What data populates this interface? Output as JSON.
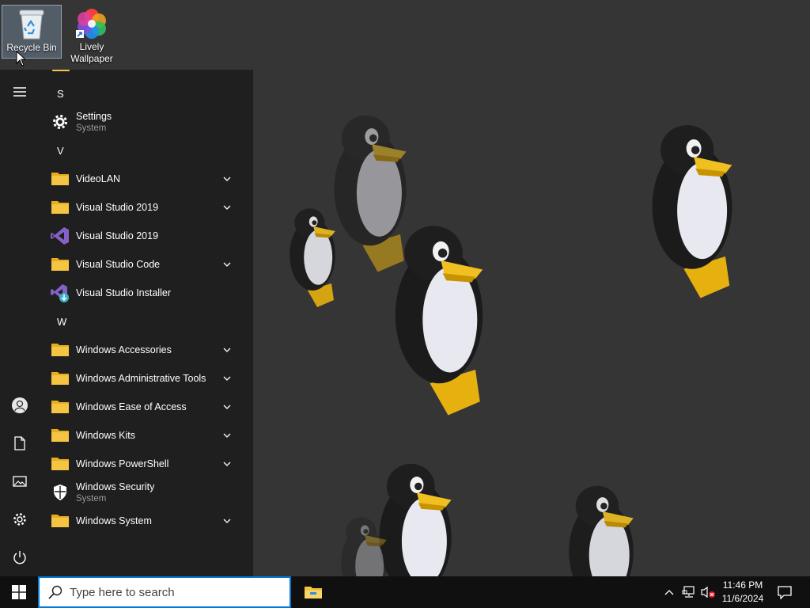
{
  "desktop": {
    "icons": [
      {
        "label": "Recycle Bin",
        "icon": "recycle-bin-icon"
      },
      {
        "label": "Lively Wallpaper",
        "icon": "lively-wallpaper-icon"
      }
    ],
    "wallpaper": "penguin-wallpaper"
  },
  "start_menu": {
    "rail": {
      "menu_icon": "hamburger-icon",
      "account_icon": "user-icon",
      "documents_icon": "document-icon",
      "pictures_icon": "pictures-icon",
      "settings_icon": "gear-icon",
      "power_icon": "power-icon"
    },
    "groups": [
      {
        "letter": "S",
        "items": [
          {
            "name": "Settings",
            "sub": "System",
            "icon": "gear-icon",
            "expandable": false
          }
        ]
      },
      {
        "letter": "V",
        "items": [
          {
            "name": "VideoLAN",
            "icon": "folder-icon",
            "expandable": true
          },
          {
            "name": "Visual Studio 2019",
            "icon": "folder-icon",
            "expandable": true
          },
          {
            "name": "Visual Studio 2019",
            "icon": "visual-studio-icon",
            "expandable": false
          },
          {
            "name": "Visual Studio Code",
            "icon": "folder-icon",
            "expandable": true
          },
          {
            "name": "Visual Studio Installer",
            "icon": "visual-studio-installer-icon",
            "expandable": false
          }
        ]
      },
      {
        "letter": "W",
        "items": [
          {
            "name": "Windows Accessories",
            "icon": "folder-icon",
            "expandable": true
          },
          {
            "name": "Windows Administrative Tools",
            "icon": "folder-icon",
            "expandable": true
          },
          {
            "name": "Windows Ease of Access",
            "icon": "folder-icon",
            "expandable": true
          },
          {
            "name": "Windows Kits",
            "icon": "folder-icon",
            "expandable": true
          },
          {
            "name": "Windows PowerShell",
            "icon": "folder-icon",
            "expandable": true
          },
          {
            "name": "Windows Security",
            "sub": "System",
            "icon": "shield-icon",
            "expandable": false
          },
          {
            "name": "Windows System",
            "icon": "folder-icon",
            "expandable": true
          }
        ]
      }
    ]
  },
  "taskbar": {
    "search_placeholder": "Type here to search",
    "pinned": [
      {
        "name": "File Explorer",
        "icon": "file-explorer-icon"
      }
    ],
    "tray": {
      "overflow_icon": "chevron-up-icon",
      "network_icon": "network-icon",
      "volume_icon": "volume-muted-icon"
    },
    "time": "11:46 PM",
    "date": "11/6/2024",
    "notification_icon": "action-center-icon"
  },
  "colors": {
    "accent": "#0078d7",
    "folder": "#f4c542",
    "start_menu_bg": "#1f1f1f",
    "taskbar_bg": "#101010",
    "vs_purple": "#8661c5"
  }
}
